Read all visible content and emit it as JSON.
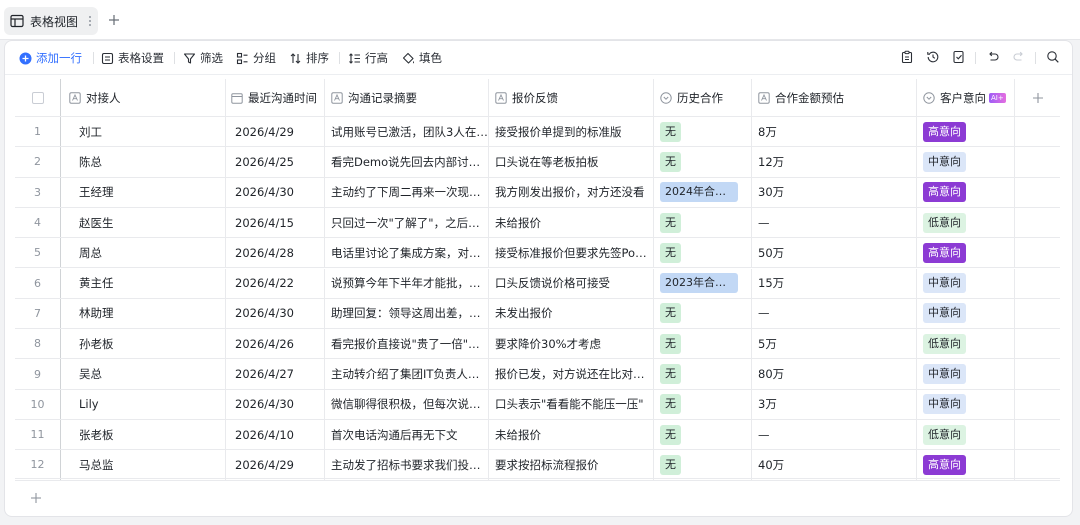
{
  "view_tab": {
    "label": "表格视图"
  },
  "toolbar": {
    "add_row": "添加一行",
    "table_settings": "表格设置",
    "filter": "筛选",
    "group": "分组",
    "sort": "排序",
    "row_height": "行高",
    "fill": "填色"
  },
  "columns": {
    "contact": "对接人",
    "last_time": "最近沟通时间",
    "summary": "沟通记录摘要",
    "quote": "报价反馈",
    "history": "历史合作",
    "amount": "合作金额预估",
    "intent": "客户意向",
    "ai_badge": "AI+"
  },
  "rows": [
    {
      "idx": "1",
      "contact": "刘工",
      "time": "2026/4/29",
      "summary": "试用账号已激活，团队3人在…",
      "quote": "接受报价单提到的标准版",
      "history": "无",
      "amount": "8万",
      "intent": "高意向"
    },
    {
      "idx": "2",
      "contact": "陈总",
      "time": "2026/4/25",
      "summary": "看完Demo说先回去内部讨论…",
      "quote": "口头说在等老板拍板",
      "history": "无",
      "amount": "12万",
      "intent": "中意向"
    },
    {
      "idx": "3",
      "contact": "王经理",
      "time": "2026/4/30",
      "summary": "主动约了下周二再来一次现场…",
      "quote": "我方刚发出报价，对方还没看",
      "history": "2024年合作…",
      "amount": "30万",
      "intent": "高意向"
    },
    {
      "idx": "4",
      "contact": "赵医生",
      "time": "2026/4/15",
      "summary": "只回过一次\"了解了\"，之后已…",
      "quote": "未给报价",
      "history": "无",
      "amount": "—",
      "intent": "低意向"
    },
    {
      "idx": "5",
      "contact": "周总",
      "time": "2026/4/28",
      "summary": "电话里讨论了集成方案，对方…",
      "quote": "接受标准报价但要求先签PoC…",
      "history": "无",
      "amount": "50万",
      "intent": "高意向"
    },
    {
      "idx": "6",
      "contact": "黄主任",
      "time": "2026/4/22",
      "summary": "说预算今年下半年才能批，让…",
      "quote": "口头反馈说价格可接受",
      "history": "2023年合作…",
      "amount": "15万",
      "intent": "中意向"
    },
    {
      "idx": "7",
      "contact": "林助理",
      "time": "2026/4/30",
      "summary": "助理回复：领导这周出差，回…",
      "quote": "未发出报价",
      "history": "无",
      "amount": "—",
      "intent": "中意向"
    },
    {
      "idx": "8",
      "contact": "孙老板",
      "time": "2026/4/26",
      "summary": "看完报价直接说\"贵了一倍\"，…",
      "quote": "要求降价30%才考虑",
      "history": "无",
      "amount": "5万",
      "intent": "低意向"
    },
    {
      "idx": "9",
      "contact": "吴总",
      "time": "2026/4/27",
      "summary": "主动转介绍了集团IT负责人，…",
      "quote": "报价已发，对方说还在比对方…",
      "history": "无",
      "amount": "80万",
      "intent": "中意向"
    },
    {
      "idx": "10",
      "contact": "Lily",
      "time": "2026/4/30",
      "summary": "微信聊得很积极，但每次说到…",
      "quote": "口头表示\"看看能不能压一压\"",
      "history": "无",
      "amount": "3万",
      "intent": "中意向"
    },
    {
      "idx": "11",
      "contact": "张老板",
      "time": "2026/4/10",
      "summary": "首次电话沟通后再无下文",
      "quote": "未给报价",
      "history": "无",
      "amount": "—",
      "intent": "低意向"
    },
    {
      "idx": "12",
      "contact": "马总监",
      "time": "2026/4/29",
      "summary": "主动发了招标书要求我们投标…",
      "quote": "要求按招标流程报价",
      "history": "无",
      "amount": "40万",
      "intent": "高意向"
    }
  ],
  "colors": {
    "accent": "#3370ff",
    "tag_green": "#d0efd9",
    "tag_blue": "#c2d8f5",
    "intent_high": "#8c3bd4",
    "intent_mid": "#dbe6f8",
    "intent_low": "#dcf3e2"
  }
}
